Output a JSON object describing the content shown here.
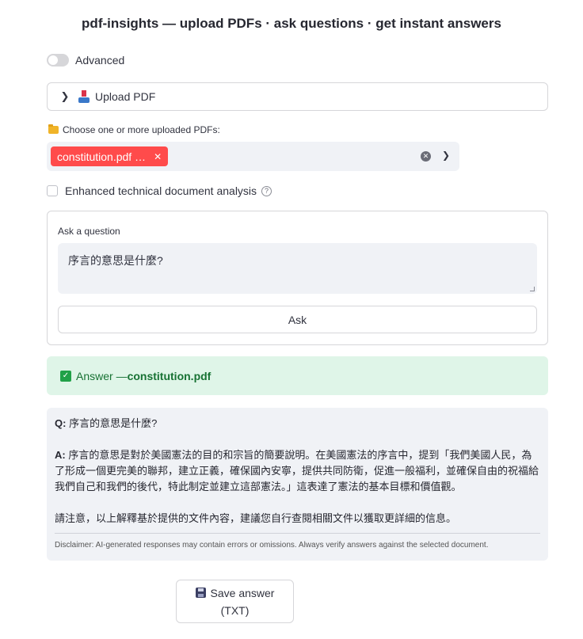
{
  "header": {
    "title": "pdf-insights — upload PDFs · ask questions · get instant answers"
  },
  "advanced_toggle": {
    "label": "Advanced",
    "enabled": false
  },
  "upload_expander": {
    "label": "Upload PDF",
    "icon": "inbox-tray-icon"
  },
  "pdf_select": {
    "label": "Choose one or more uploaded PDFs:",
    "icon": "folder-icon",
    "selected_chip": "constitution.pdf …",
    "chip_color": "#ff4b4b"
  },
  "enhanced_analysis": {
    "label": "Enhanced technical document analysis",
    "checked": false
  },
  "question_form": {
    "label": "Ask a question",
    "value": "序言的意思是什麼?",
    "submit_label": "Ask"
  },
  "answer_status": {
    "prefix": "Answer — ",
    "document": "constitution.pdf",
    "color": "#21a148"
  },
  "answer": {
    "q_label": "Q:",
    "question": " 序言的意思是什麼?",
    "a_label": "A:",
    "answer_text": " 序言的意思是對於美國憲法的目的和宗旨的簡要說明。在美國憲法的序言中，提到「我們美國人民，為了形成一個更完美的聯邦，建立正義，確保國內安寧，提供共同防衛，促進一般福利，並確保自由的祝福給我們自己和我們的後代，特此制定並建立這部憲法。」這表達了憲法的基本目標和價值觀。",
    "note": "請注意，以上解釋基於提供的文件內容，建議您自行查閱相關文件以獲取更詳細的信息。",
    "disclaimer": "Disclaimer: AI-generated responses may contain errors or omissions. Always verify answers against the selected document."
  },
  "save_button": {
    "line1": "Save answer",
    "line2": "(TXT)",
    "icon": "floppy-disk-icon"
  }
}
